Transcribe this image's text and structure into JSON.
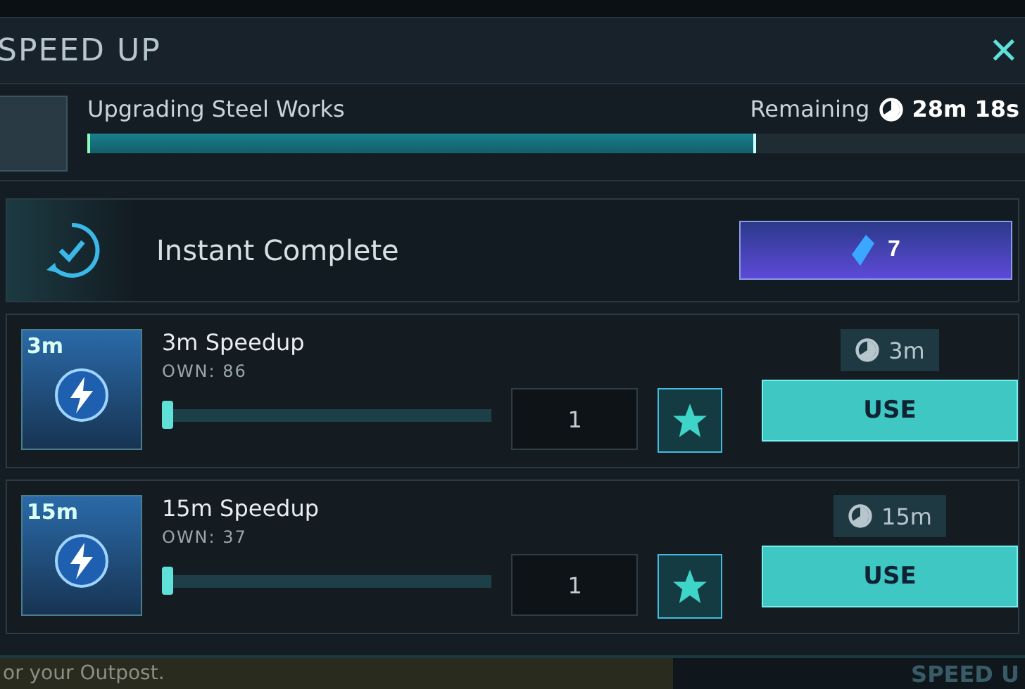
{
  "header": {
    "title": "SPEED UP",
    "close": "✕"
  },
  "progress": {
    "label": "Upgrading Steel Works",
    "remaining_label": "Remaining",
    "remaining_time": "28m 18s",
    "level": 0.71
  },
  "instant": {
    "label": "Instant Complete",
    "cost": "7"
  },
  "items": [
    {
      "badge": "3m",
      "name": "3m Speedup",
      "own": "OWN: 86",
      "level": 0,
      "quantity": "1",
      "time": "3m",
      "button": "USE"
    },
    {
      "badge": "15m",
      "name": "15m Speedup",
      "own": "OWN: 37",
      "level": 0,
      "quantity": "1",
      "time": "15m",
      "button": "USE"
    }
  ],
  "footer": {
    "hint": "or your Outpost.",
    "button": "SPEED U"
  }
}
